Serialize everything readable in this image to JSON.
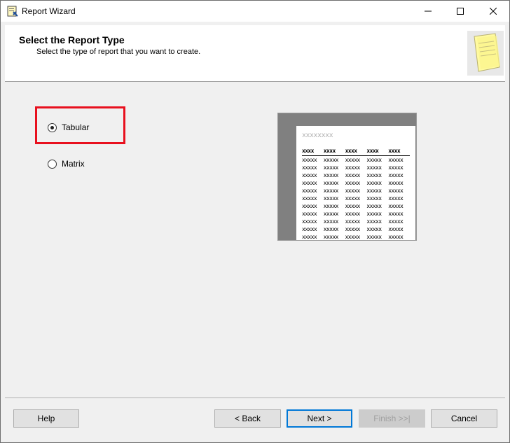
{
  "window": {
    "title": "Report Wizard"
  },
  "header": {
    "title": "Select the Report Type",
    "subtitle": "Select the type of report that you want to create."
  },
  "options": [
    {
      "label": "Tabular",
      "selected": true
    },
    {
      "label": "Matrix",
      "selected": false
    }
  ],
  "preview": {
    "title_placeholder": "xxxxxxxx",
    "header_cells": [
      "xxxx",
      "xxxx",
      "xxxx",
      "xxxx",
      "xxxx"
    ],
    "row_cell": "xxxxx",
    "row_count": 11
  },
  "buttons": {
    "help": "Help",
    "back": "< Back",
    "next": "Next >",
    "finish": "Finish >>|",
    "cancel": "Cancel"
  },
  "colors": {
    "highlight": "#e8101e",
    "accent": "#0078d7"
  }
}
